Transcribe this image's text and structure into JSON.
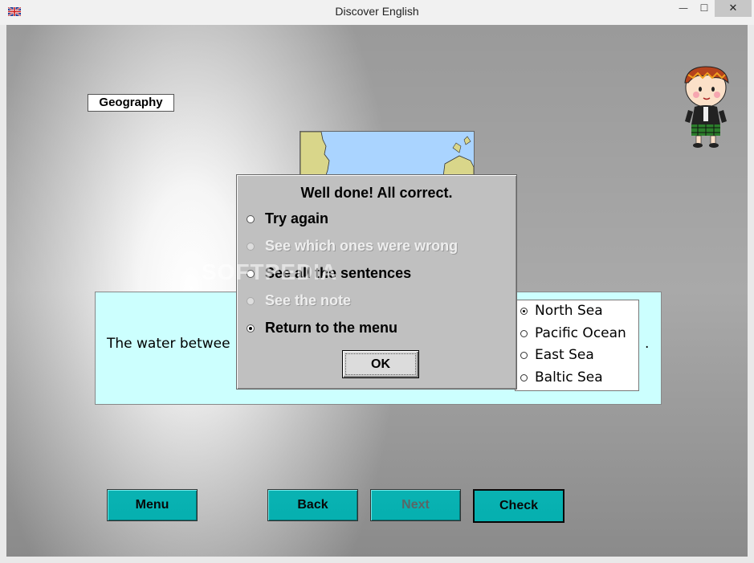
{
  "window": {
    "title": "Discover English",
    "minimize_glyph": "—",
    "maximize_glyph": "☐",
    "close_glyph": "✕",
    "flag_icon": "uk-flag-icon"
  },
  "lesson": {
    "category": "Geography"
  },
  "watermark": "SOFTPEDIA",
  "question": {
    "text_before": "The water betwee",
    "text_after": ".",
    "options": [
      {
        "label": "North Sea",
        "selected": true
      },
      {
        "label": "Pacific Ocean",
        "selected": false
      },
      {
        "label": "East Sea",
        "selected": false
      },
      {
        "label": "Baltic Sea",
        "selected": false
      }
    ]
  },
  "dialog": {
    "title": "Well done! All correct.",
    "items": [
      {
        "label": "Try again",
        "enabled": true,
        "selected": false
      },
      {
        "label": "See which ones were wrong",
        "enabled": false,
        "selected": false
      },
      {
        "label": "See all the sentences",
        "enabled": true,
        "selected": false
      },
      {
        "label": "See the note",
        "enabled": false,
        "selected": false
      },
      {
        "label": "Return to the menu",
        "enabled": true,
        "selected": true
      }
    ],
    "ok_label": "OK"
  },
  "nav": {
    "menu_label": "Menu",
    "back_label": "Back",
    "next_label": "Next",
    "check_label": "Check"
  },
  "colors": {
    "nav_button": "#00bfbf",
    "question_panel": "#ccfffe",
    "map_water": "#aad4ff",
    "map_land": "#d9d68a",
    "dialog_bg": "#c0c0c0"
  }
}
